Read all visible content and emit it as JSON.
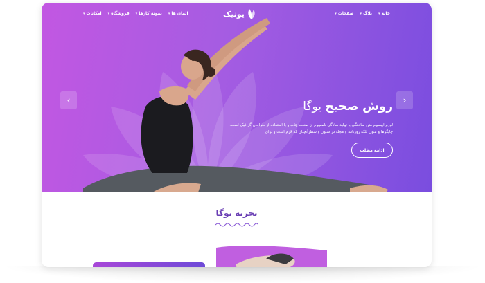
{
  "nav": {
    "left_items": [
      {
        "label": "امکانات",
        "has_caret": true
      },
      {
        "label": "فروشگاه",
        "has_caret": true
      },
      {
        "label": "نمونه کارها",
        "has_caret": true
      },
      {
        "label": "المان ها",
        "has_caret": true
      }
    ],
    "right_items": [
      {
        "label": "خانه",
        "has_caret": true
      },
      {
        "label": "بلاگ",
        "has_caret": true
      },
      {
        "label": "صفحات",
        "has_caret": true
      }
    ],
    "logo_text": "یونیک",
    "logo_icon": "leaf-icon"
  },
  "hero": {
    "title_bold": "روش صحیح",
    "title_rest": "یوگا",
    "description": "لورم ایپسوم متن ساختگی با تولید سادگی نامفهوم از صنعت چاپ و با استفاده از طراحان گرافیک است. چاپگرها و متون بلکه روزنامه و مجله در ستون و سطرآنچنان که لازم است و برای",
    "cta_label": "ادامه مطلب",
    "prev_icon": "chevron-left-icon",
    "next_icon": "chevron-right-icon",
    "gradient_start": "#c257e2",
    "gradient_end": "#7a4ddf"
  },
  "section": {
    "title": "تجربه یوگا",
    "accent_color": "#6a3fb4"
  }
}
